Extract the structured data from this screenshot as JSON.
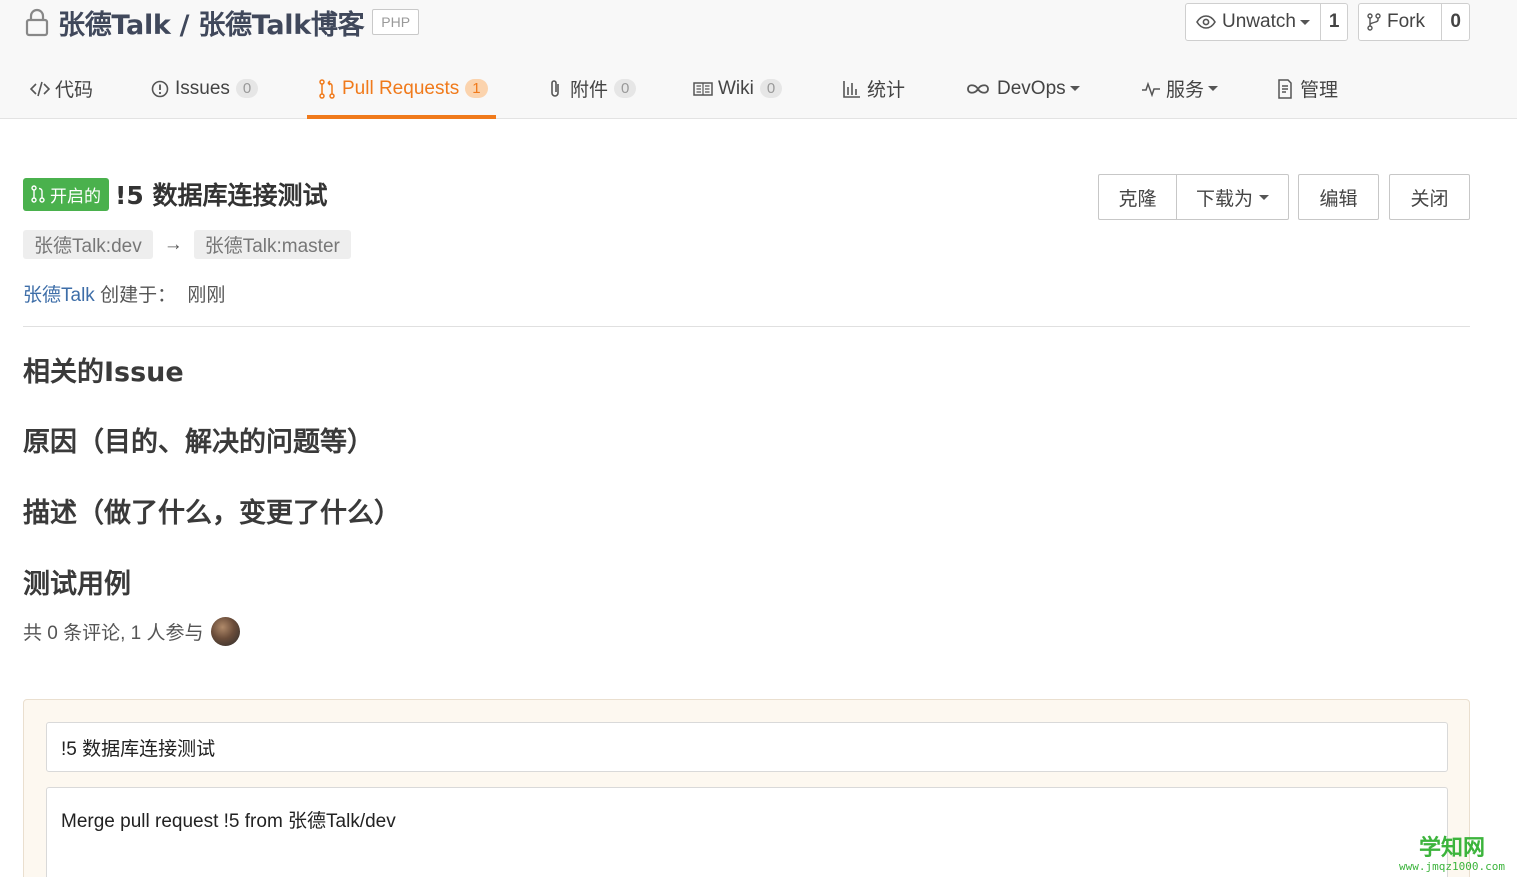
{
  "repo": {
    "title": "张德Talk / 张德Talk博客",
    "language": "PHP",
    "watch": {
      "label": "Unwatch",
      "count": "1"
    },
    "fork": {
      "label": "Fork",
      "count": "0"
    }
  },
  "tabs": [
    {
      "label": "代码",
      "icon": "code-icon"
    },
    {
      "label": "Issues",
      "count": "0",
      "icon": "issue-icon"
    },
    {
      "label": "Pull Requests",
      "count": "1",
      "icon": "pull-request-icon",
      "active": true
    },
    {
      "label": "附件",
      "count": "0",
      "icon": "paperclip-icon"
    },
    {
      "label": "Wiki",
      "count": "0",
      "icon": "book-icon"
    },
    {
      "label": "统计",
      "icon": "bar-chart-icon"
    },
    {
      "label": "DevOps",
      "icon": "infinity-icon"
    },
    {
      "label": "服务",
      "icon": "pulse-icon"
    },
    {
      "label": "管理",
      "icon": "document-icon"
    }
  ],
  "pr": {
    "status": "开启的",
    "title": "!5 数据库连接测试",
    "source_branch": "张德Talk:dev",
    "target_branch": "张德Talk:master",
    "author": "张德Talk",
    "created_label": "创建于：",
    "created_time": "刚刚"
  },
  "actions": {
    "clone": "克隆",
    "download": "下载为",
    "edit": "编辑",
    "close": "关闭"
  },
  "sections": {
    "related_issue": "相关的Issue",
    "reason": "原因（目的、解决的问题等）",
    "description": "描述（做了什么，变更了什么）",
    "test_cases": "测试用例"
  },
  "comments": {
    "summary": "共 0 条评论, 1 人参与"
  },
  "merge": {
    "title_value": "!5 数据库连接测试",
    "message_value": "Merge pull request !5 from 张德Talk/dev"
  },
  "watermark": {
    "name": "学知网",
    "url": "www.jmqz1000.com"
  },
  "colors": {
    "accent": "#f07a1b",
    "status_open": "#4ab14d",
    "link": "#3e6ea8"
  }
}
